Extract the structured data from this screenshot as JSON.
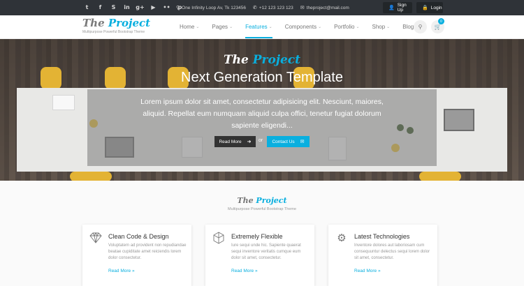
{
  "topbar": {
    "social_icons": [
      {
        "name": "twitter-icon",
        "glyph": "t"
      },
      {
        "name": "facebook-icon",
        "glyph": "f"
      },
      {
        "name": "skype-icon",
        "glyph": "S"
      },
      {
        "name": "linkedin-icon",
        "glyph": "in"
      },
      {
        "name": "google-plus-icon",
        "glyph": "g+"
      },
      {
        "name": "youtube-icon",
        "glyph": "▶"
      },
      {
        "name": "flickr-icon",
        "glyph": "••"
      },
      {
        "name": "pinterest-icon",
        "glyph": "p"
      }
    ],
    "address": "One Infinity Loop Av, Tk 123456",
    "phone": "+12 123 123 123",
    "email": "theproject@mail.com",
    "signup_label": "Sign Up",
    "login_label": "Login"
  },
  "header": {
    "logo_prefix": "The",
    "logo_accent": "Project",
    "tagline": "Multipurpose Powerful Bootstrap Theme",
    "nav": [
      {
        "label": "Home",
        "caret": "⌄"
      },
      {
        "label": "Pages",
        "caret": "⌄"
      },
      {
        "label": "Features",
        "caret": "⌄"
      },
      {
        "label": "Components",
        "caret": "⌄"
      },
      {
        "label": "Portfolio",
        "caret": "⌄"
      },
      {
        "label": "Shop",
        "caret": "⌄"
      },
      {
        "label": "Blog",
        "caret": "⌄"
      }
    ],
    "active_nav": "Features",
    "cart_count": "0"
  },
  "hero": {
    "logo_prefix": "The",
    "logo_accent": "Project",
    "title": "Next Generation Template",
    "text": "Lorem ipsum dolor sit amet, consectetur adipisicing elit. Nesciunt, maiores, aliquid. Repellat eum numquam aliquid culpa offici, tenetur fugiat dolorum sapiente eligendi...",
    "read_more_label": "Read More",
    "or_label": "or",
    "contact_label": "Contact Us"
  },
  "section": {
    "logo_prefix": "The",
    "logo_accent": "Project",
    "subtitle": "Multipurpose Powerful Bootstrap Theme"
  },
  "features": [
    {
      "title": "Clean Code & Design",
      "text": "Voluptatem ad provident non repudiandae beatae cupiditate amet reiciendis lorem dolor consectetur.",
      "link": "Read More »"
    },
    {
      "title": "Extremely Flexible",
      "text": "Iure sequi unde hic. Sapiente quaerat sequi inventore veritatis cumque eum dolor sit amet, consectetur.",
      "link": "Read More »"
    },
    {
      "title": "Latest Technologies",
      "text": "Inventore dolores aut laboriosam cum consequuntur delectus sequi lorem dolor sit amet, consectetur.",
      "link": "Read More »"
    }
  ],
  "colors": {
    "accent": "#09afdf",
    "topbar": "#2f3338",
    "dark_button": "#333333"
  }
}
